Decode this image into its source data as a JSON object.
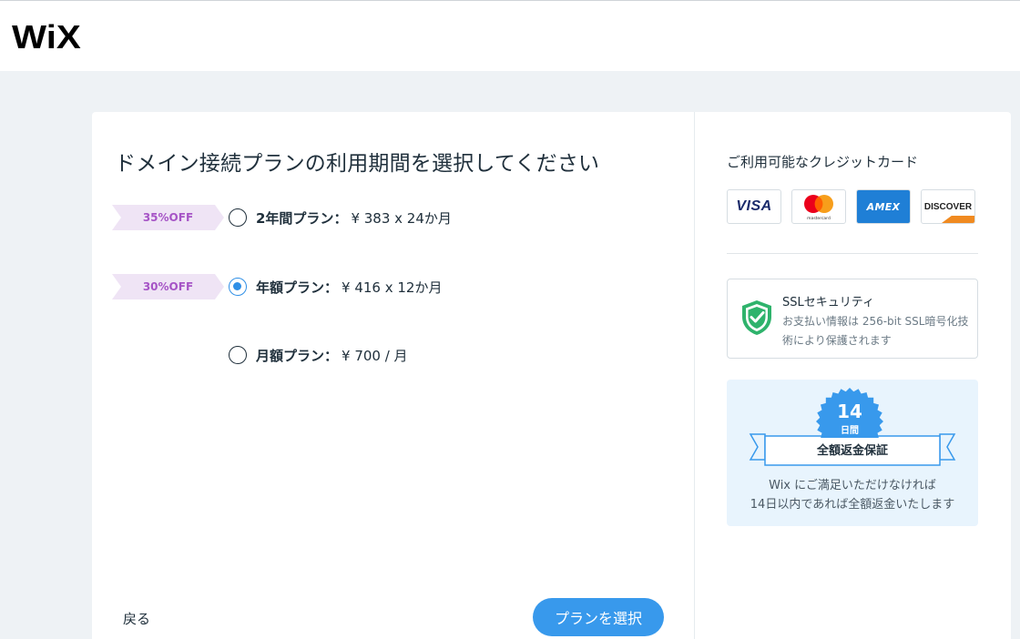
{
  "header": {
    "logo_text": "WiX"
  },
  "main": {
    "title": "ドメイン接続プランの利用期間を選択してください",
    "plans": [
      {
        "badge": "35%OFF",
        "name": "2年間プラン：",
        "price": "¥ 383 x 24か月",
        "selected": false
      },
      {
        "badge": "30%OFF",
        "name": "年額プラン：",
        "price": "¥ 416 x 12か月",
        "selected": true
      },
      {
        "badge": "",
        "name": "月額プラン：",
        "price": "¥ 700 / 月",
        "selected": false
      }
    ],
    "back_label": "戻る",
    "select_label": "プランを選択"
  },
  "sidebar": {
    "cards_title": "ご利用可能なクレジットカード",
    "cards": [
      {
        "brand": "visa-icon",
        "label": "VISA"
      },
      {
        "brand": "mastercard-icon",
        "label": "mastercard"
      },
      {
        "brand": "amex-icon",
        "label": "AMEX"
      },
      {
        "brand": "discover-icon",
        "label": "DISCOVER"
      }
    ],
    "ssl": {
      "title": "SSLセキュリティ",
      "description": "お支払い情報は 256-bit SSL暗号化技術により保護されます"
    },
    "guarantee": {
      "days": "14",
      "days_unit": "日間",
      "banner": "全額返金保証",
      "line1": "Wix にご満足いただけなければ",
      "line2": "14日以内であれば全額返金いたします"
    }
  },
  "colors": {
    "accent": "#3899ec",
    "badge_bg": "#efe4f5",
    "badge_text": "#a654c6",
    "shield": "#2fb36c",
    "guarantee_bg": "#e8f4fd"
  }
}
